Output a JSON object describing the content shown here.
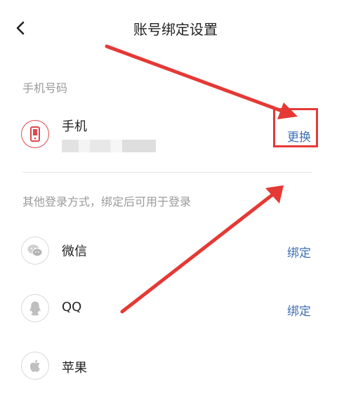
{
  "header": {
    "title": "账号绑定设置"
  },
  "phone_section": {
    "label": "手机号码",
    "item": {
      "title": "手机",
      "number_mask": "",
      "action": "更换"
    }
  },
  "other_section": {
    "label": "其他登录方式，绑定后可用于登录",
    "items": [
      {
        "title": "微信",
        "action": "绑定"
      },
      {
        "title": "QQ",
        "action": "绑定"
      },
      {
        "title": "苹果",
        "action": ""
      }
    ]
  },
  "colors": {
    "accent": "#3f6fb5",
    "phone_icon": "#e0474c",
    "annotation": "#e53935"
  }
}
